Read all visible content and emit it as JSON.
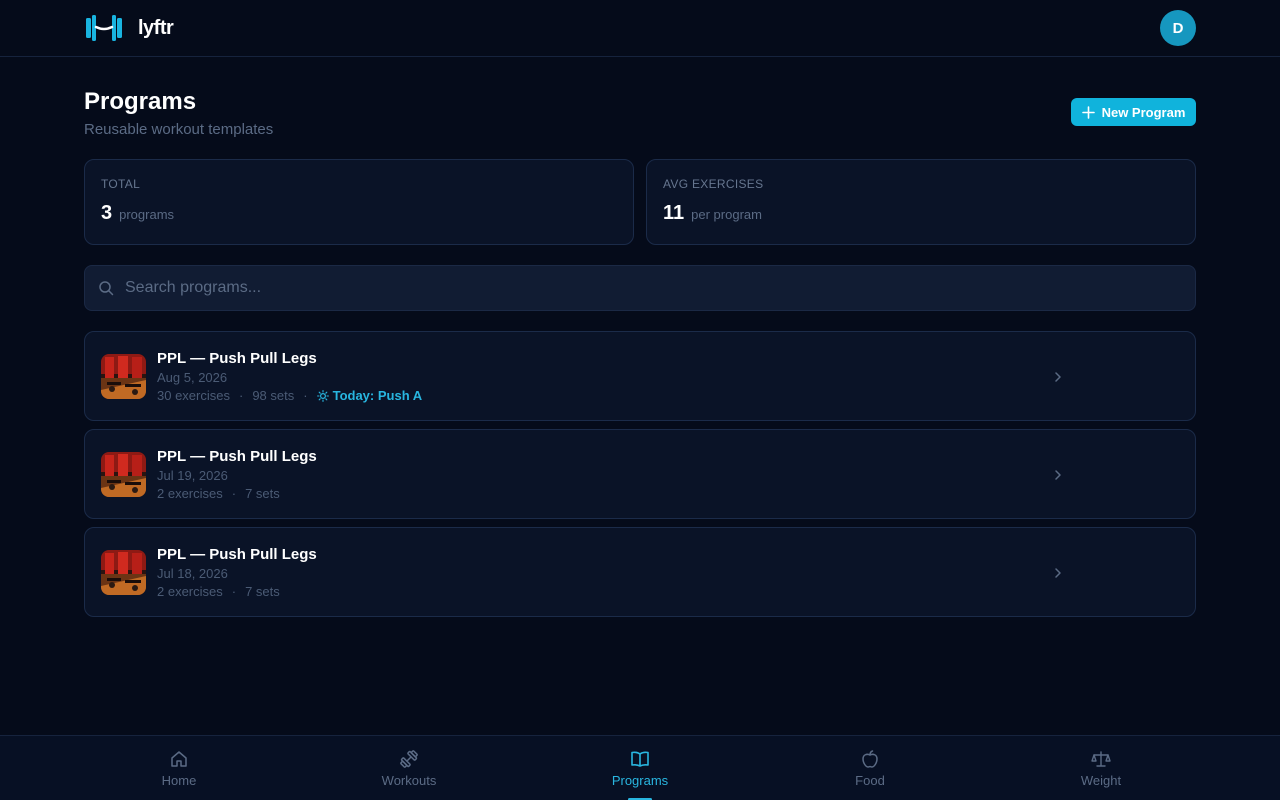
{
  "app": {
    "name": "lyftr",
    "avatar_initial": "D"
  },
  "page": {
    "title": "Programs",
    "subtitle": "Reusable workout templates",
    "new_button_label": "New Program"
  },
  "stats": {
    "total": {
      "label": "TOTAL",
      "value": "3",
      "unit": "programs"
    },
    "avg": {
      "label": "AVG EXERCISES",
      "value": "11",
      "unit": "per program"
    }
  },
  "search": {
    "placeholder": "Search programs..."
  },
  "programs": [
    {
      "title": "PPL — Push Pull Legs",
      "date": "Aug 5, 2026",
      "exercises": "30 exercises",
      "sets": "98 sets",
      "today": "Today: Push A"
    },
    {
      "title": "PPL — Push Pull Legs",
      "date": "Jul 19, 2026",
      "exercises": "2 exercises",
      "sets": "7 sets"
    },
    {
      "title": "PPL — Push Pull Legs",
      "date": "Jul 18, 2026",
      "exercises": "2 exercises",
      "sets": "7 sets"
    }
  ],
  "nav": [
    {
      "label": "Home",
      "icon": "home-icon"
    },
    {
      "label": "Workouts",
      "icon": "dumbbell-icon"
    },
    {
      "label": "Programs",
      "icon": "book-icon",
      "active": true
    },
    {
      "label": "Food",
      "icon": "apple-icon"
    },
    {
      "label": "Weight",
      "icon": "scale-icon"
    }
  ],
  "colors": {
    "accent": "#10b3dc",
    "background": "#050b1a",
    "card": "#0a1327"
  }
}
